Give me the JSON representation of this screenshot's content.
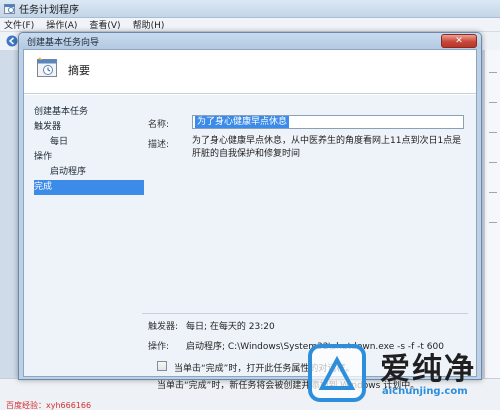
{
  "main_window": {
    "title": "任务计划程序",
    "menu": [
      "文件(F)",
      "操作(A)",
      "查看(V)",
      "帮助(H)"
    ]
  },
  "wizard": {
    "title": "创建基本任务向导",
    "close_glyph": "✕",
    "header_title": "摘要",
    "steps": [
      {
        "label": "创建基本任务",
        "level": 0,
        "active": false
      },
      {
        "label": "触发器",
        "level": 0,
        "active": false
      },
      {
        "label": "每日",
        "level": 1,
        "active": false
      },
      {
        "label": "操作",
        "level": 0,
        "active": false
      },
      {
        "label": "启动程序",
        "level": 1,
        "active": false
      },
      {
        "label": "完成",
        "level": 0,
        "active": true
      }
    ],
    "name_label": "名称:",
    "name_value": "为了身心健康早点休息",
    "desc_label": "描述:",
    "desc_value": "为了身心健康早点休息，从中医养生的角度看网上11点到次日1点是肝脏的自我保护和修复时间",
    "trigger_label": "触发器:",
    "trigger_value": "每日; 在每天的 23:20",
    "action_label": "操作:",
    "action_value": "启动程序; C:\\Windows\\System32\\shutdown.exe -s -f -t 600",
    "checkbox_checked": false,
    "checkbox_label": "当单击“完成”时，打开此任务属性的对话框。",
    "note": "当单击“完成”时，新任务将会被创建并添加到 Windows 计划中。"
  },
  "status_text": "百度经验：xyh666166",
  "watermark": {
    "brand": "爱纯净",
    "url": "aichunjing.com"
  },
  "colors": {
    "selection": "#3c8be8",
    "watermark_blue": "#2d8fdc"
  }
}
